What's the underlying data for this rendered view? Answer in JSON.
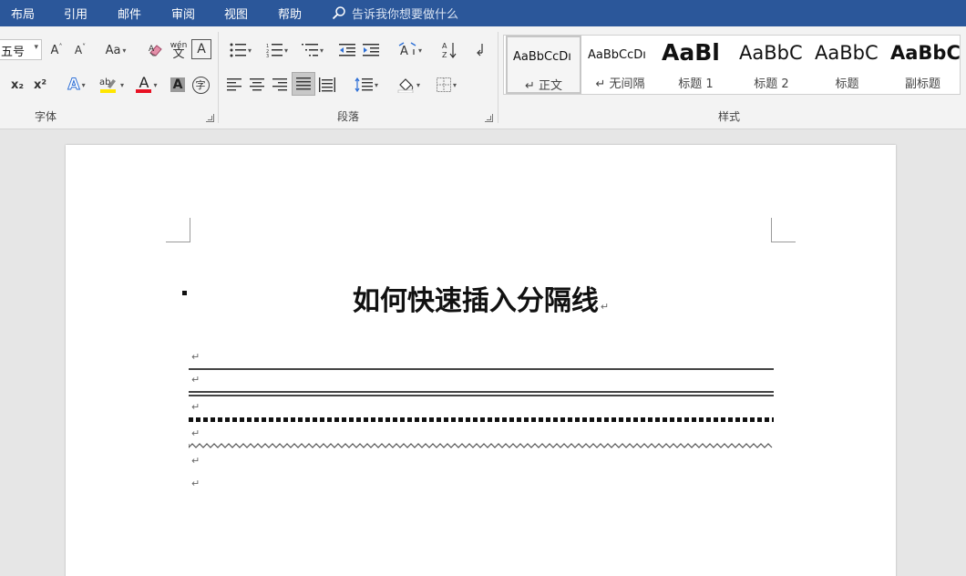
{
  "menu": {
    "items": [
      {
        "label": "布局"
      },
      {
        "label": "引用"
      },
      {
        "label": "邮件"
      },
      {
        "label": "审阅"
      },
      {
        "label": "视图"
      },
      {
        "label": "帮助"
      }
    ],
    "tell_me": "告诉我你想要做什么"
  },
  "ribbon": {
    "font_group": {
      "label": "字体",
      "font_size": "五号",
      "grow_font": "A",
      "shrink_font": "A",
      "change_case": "Aa",
      "subscript": "x₂",
      "superscript": "x²",
      "text_effects": "A",
      "font_color": "A",
      "char_shading": "A",
      "enclose_char": "字",
      "phonetic_top": "wén",
      "phonetic_bottom": "文",
      "char_border": "A",
      "font_color_value": "#e81123",
      "highlight_color_value": "#ffe600"
    },
    "paragraph_group": {
      "label": "段落"
    },
    "styles_group": {
      "label": "样式",
      "items": [
        {
          "sample": "AaBbCcDı",
          "name": "↵ 正文"
        },
        {
          "sample": "AaBbCcDı",
          "name": "↵ 无间隔"
        },
        {
          "sample": "AaBl",
          "name": "标题 1"
        },
        {
          "sample": "AaBbC",
          "name": "标题 2"
        },
        {
          "sample": "AaBbC",
          "name": "标题"
        },
        {
          "sample": "AaBbC",
          "name": "副标题"
        }
      ]
    }
  },
  "document": {
    "title": "如何快速插入分隔线",
    "paragraph_mark": "↵"
  }
}
